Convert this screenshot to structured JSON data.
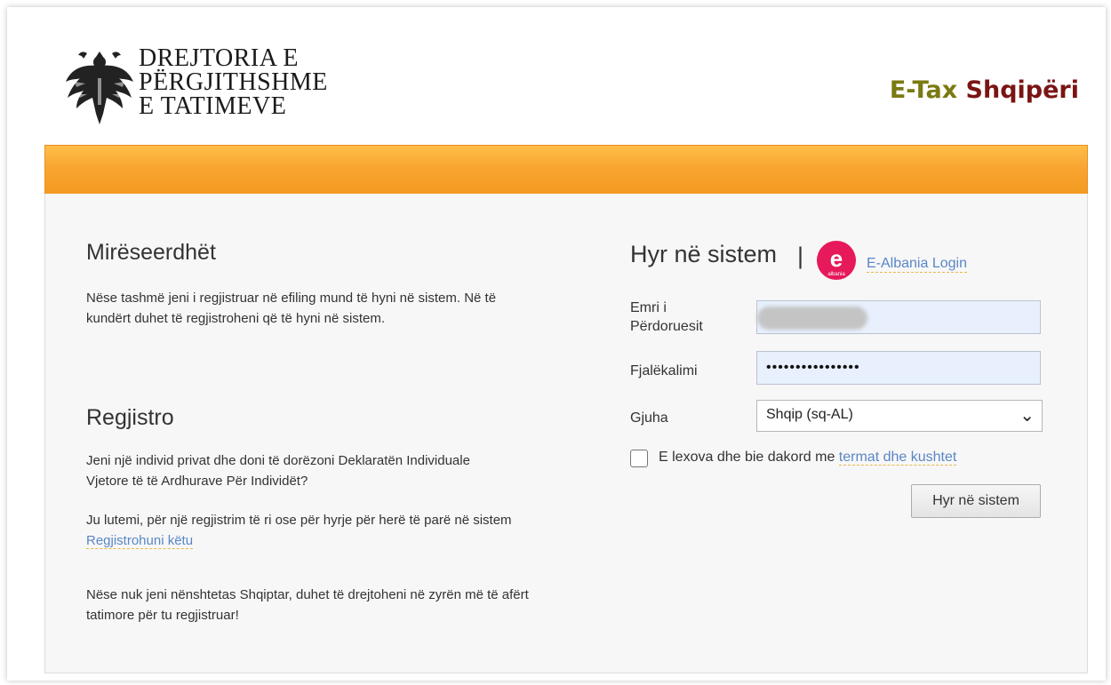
{
  "header": {
    "logo_line1": "DREJTORIA E",
    "logo_line2": "PËRGJITHSHME",
    "logo_line3": "E TATIMEVE",
    "brand_part1": "E-Tax",
    "brand_part2": "Shqipëri",
    "eagle_icon": "double-headed-eagle-emblem"
  },
  "welcome": {
    "title": "Mirëseerdhët",
    "text": "Nëse tashmë jeni i regjistruar në efiling mund të hyni në sistem. Në të kundërt duhet të regjistroheni që të hyni në sistem."
  },
  "register": {
    "title": "Regjistro",
    "text1": "Jeni një individ privat dhe doni të dorëzoni Deklaratën Individuale Vjetore të të Ardhurave Për Individët?",
    "text2_prefix": "Ju lutemi, për një regjistrim të ri ose për hyrje për herë të parë në sistem",
    "text2_link": "Regjistrohuni këtu",
    "text3": "Nëse nuk jeni nënshtetas Shqiptar, duhet të drejtoheni në zyrën më të afërt tatimore për tu regjistruar!"
  },
  "login": {
    "title": "Hyr në sistem",
    "separator": "|",
    "ealbania_icon_letter": "e",
    "ealbania_icon_sub": "albania",
    "ealbania_link": "E-Albania Login",
    "username_label": "Emri i Përdoruesit",
    "username_value": "",
    "password_label": "Fjalëkalimi",
    "password_value": "••••••••••••••••",
    "language_label": "Gjuha",
    "language_selected": "Shqip (sq-AL)",
    "terms_prefix": "E lexova dhe bie dakord me",
    "terms_link": "termat dhe kushtet",
    "submit_label": "Hyr në sistem"
  },
  "colors": {
    "orange_bar": "#f8a631",
    "link": "#5a86c8",
    "brand_etax": "#7a7a12",
    "brand_shqiperi": "#7b1414",
    "ealbania_icon": "#e6195a",
    "input_autofill": "#e8f0fe"
  }
}
